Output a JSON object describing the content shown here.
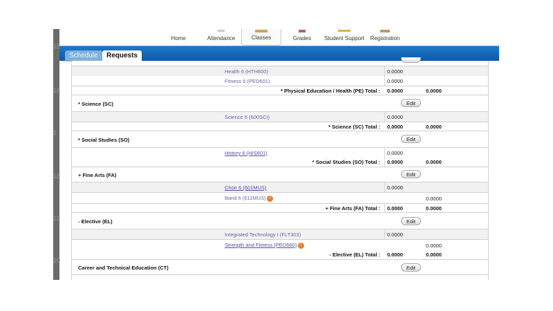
{
  "nav": {
    "items": [
      {
        "label": "Home"
      },
      {
        "label": "Attendance"
      },
      {
        "label": "Classes"
      },
      {
        "label": "Grades"
      },
      {
        "label": "Student Support"
      },
      {
        "label": "Registration"
      }
    ],
    "active_index": 2
  },
  "tabs": [
    {
      "label": "Schedule",
      "active": false
    },
    {
      "label": "Requests",
      "active": true
    }
  ],
  "rail_numbers": [
    "15",
    "16",
    "1",
    "18",
    "19",
    "20"
  ],
  "rows": {
    "r_health": {
      "course": "Health 6 (HTH600)",
      "credit": "0.0000"
    },
    "r_fitness": {
      "course": "Fitness 6 (PED601)",
      "credit": "0.0000"
    },
    "t_pe": {
      "label": "* Physical Education / Health (PE) Total :",
      "v1": "0.0000",
      "v2": "0.0000"
    },
    "s_sc": {
      "label": "* Science (SC)",
      "edit": "Edit"
    },
    "r_science": {
      "course": "Science 6 (600SCI)",
      "credit": "0.0000"
    },
    "t_sc": {
      "label": "* Science (SC) Total :",
      "v1": "0.0000",
      "v2": "0.0000"
    },
    "s_so": {
      "label": "* Social Studies (SO)",
      "edit": "Edit"
    },
    "r_history": {
      "course": "History 6 (HIS601)",
      "credit": "0.0000"
    },
    "t_so": {
      "label": "* Social Studies (SO) Total :",
      "v1": "0.0000",
      "v2": "0.0000"
    },
    "s_fa": {
      "label": "+ Fine Arts (FA)",
      "edit": "Edit"
    },
    "r_choir": {
      "course": "Choir 6 (601MUS)",
      "credit": "0.0000"
    },
    "r_band": {
      "course": "Band 6 (611MUS)",
      "credit": "0.0000"
    },
    "t_fa": {
      "label": "+ Fine Arts (FA) Total :",
      "v1": "0.0000",
      "v2": "0.0000"
    },
    "s_el": {
      "label": "- Elective (EL)",
      "edit": "Edit"
    },
    "r_tech": {
      "course": "Integrated Technology I (FLT303)",
      "credit": "0.0000"
    },
    "r_strength": {
      "course": "Strength and Fitness (PED660)",
      "credit": "0.0000"
    },
    "t_el": {
      "label": "- Elective (EL) Total :",
      "v1": "0.0000",
      "v2": "0.0000"
    },
    "s_ct": {
      "label": "Career and Technical Education (CT)",
      "edit": "Edit"
    }
  },
  "colors": {
    "blue_bar": "#0b5aa8",
    "link": "#5a4a9a",
    "info_icon": "#e2832b"
  }
}
